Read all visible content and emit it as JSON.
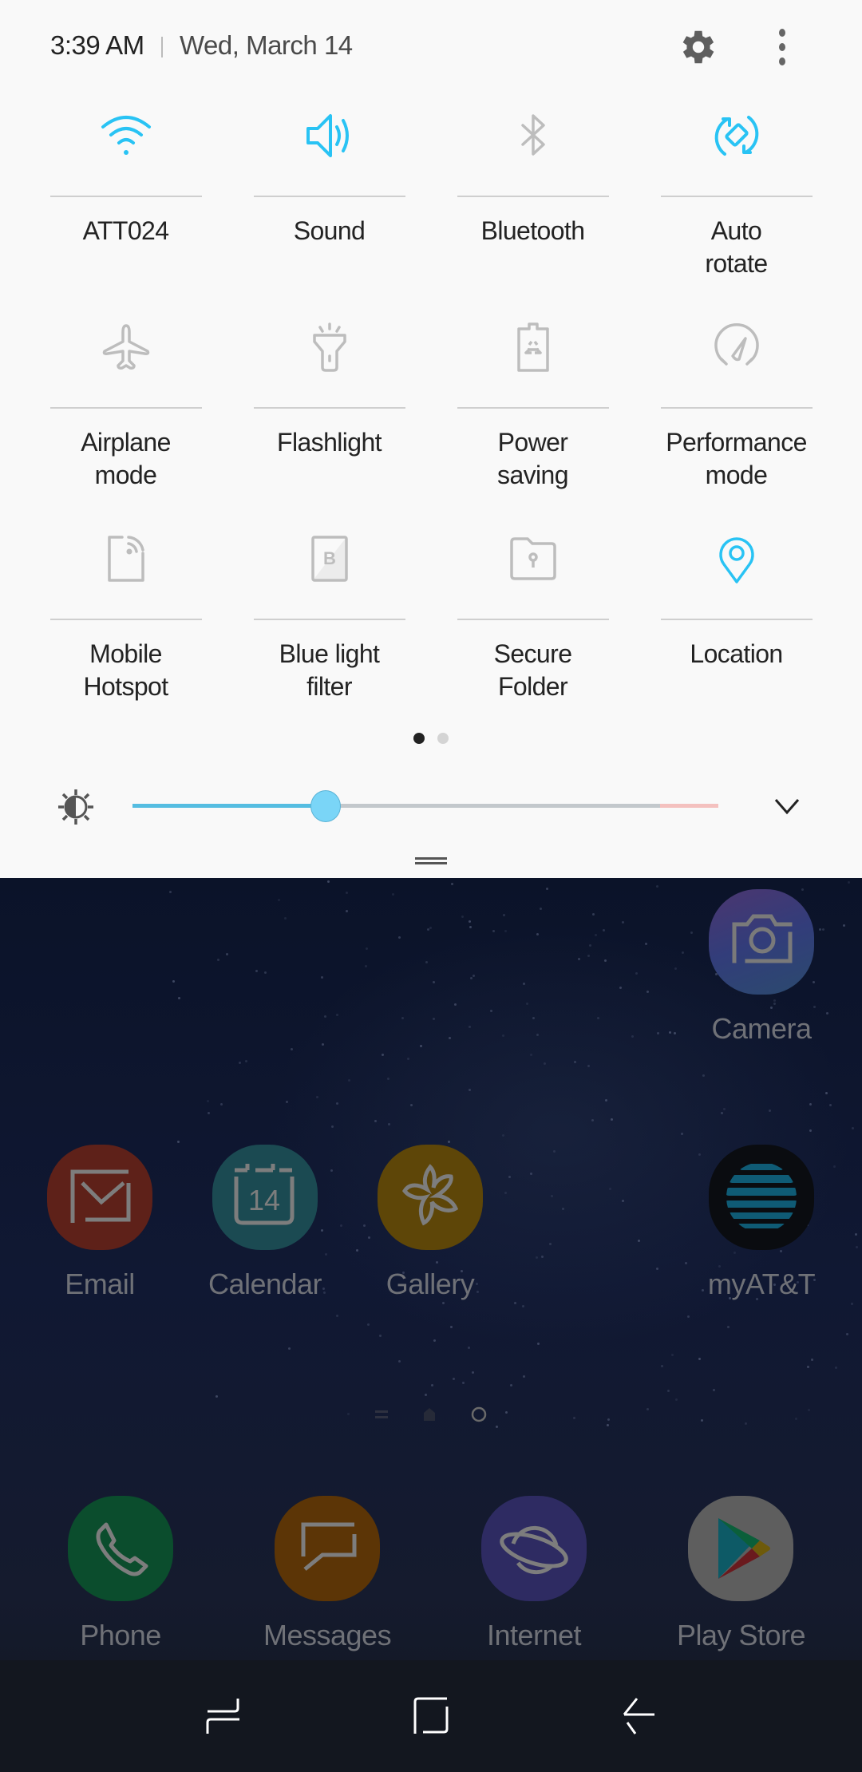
{
  "status": {
    "time": "3:39 AM",
    "date": "Wed, March 14"
  },
  "header_icons": {
    "settings": "gear-icon",
    "more": "more-vertical-icon"
  },
  "colors": {
    "accent_on": "#29c3f4",
    "icon_off": "#bdbdbd",
    "panel_bg": "#f9f9f9",
    "brightness_fill": "#55bde1",
    "brightness_warning": "#f4c1bf"
  },
  "quick_settings": {
    "page": 1,
    "page_count": 2,
    "tiles": [
      {
        "label": "ATT024",
        "icon": "wifi-icon",
        "active": true
      },
      {
        "label": "Sound",
        "icon": "volume-icon",
        "active": true
      },
      {
        "label": "Bluetooth",
        "icon": "bluetooth-icon",
        "active": false
      },
      {
        "label": "Auto\nrotate",
        "icon": "auto-rotate-icon",
        "active": true
      },
      {
        "label": "Airplane\nmode",
        "icon": "airplane-icon",
        "active": false
      },
      {
        "label": "Flashlight",
        "icon": "flashlight-icon",
        "active": false
      },
      {
        "label": "Power\nsaving",
        "icon": "power-saving-icon",
        "active": false
      },
      {
        "label": "Performance\nmode",
        "icon": "performance-icon",
        "active": false
      },
      {
        "label": "Mobile\nHotspot",
        "icon": "hotspot-icon",
        "active": false
      },
      {
        "label": "Blue light\nfilter",
        "icon": "blue-light-filter-icon",
        "active": false
      },
      {
        "label": "Secure\nFolder",
        "icon": "secure-folder-icon",
        "active": false
      },
      {
        "label": "Location",
        "icon": "location-icon",
        "active": true
      }
    ]
  },
  "brightness": {
    "icon": "brightness-icon",
    "level_percent": 33,
    "warning_from_percent": 90,
    "expand_icon": "chevron-down-icon"
  },
  "home": {
    "apps": [
      {
        "label": "Camera",
        "icon": "camera-icon",
        "color": "#3a3f7a"
      },
      {
        "label": "Email",
        "icon": "email-icon",
        "color": "#5e2119"
      },
      {
        "label": "Calendar",
        "icon": "calendar-icon",
        "color": "#1b4a52",
        "day": "14"
      },
      {
        "label": "Gallery",
        "icon": "gallery-icon",
        "color": "#5e4608"
      },
      {
        "label": "myAT&T",
        "icon": "att-icon",
        "color": "#0a0c10"
      }
    ],
    "page_indicators": [
      "briefing-icon",
      "home-page-icon",
      "page-dot-icon"
    ],
    "dock": [
      {
        "label": "Phone",
        "icon": "phone-icon",
        "color": "#0b4d2d"
      },
      {
        "label": "Messages",
        "icon": "messages-icon",
        "color": "#5c3506"
      },
      {
        "label": "Internet",
        "icon": "internet-icon",
        "color": "#2e2b62"
      },
      {
        "label": "Play Store",
        "icon": "play-store-icon",
        "color": "#5e5e5e"
      }
    ]
  },
  "navbar": {
    "recents": "recent-apps-icon",
    "home": "home-icon",
    "back": "back-icon"
  }
}
